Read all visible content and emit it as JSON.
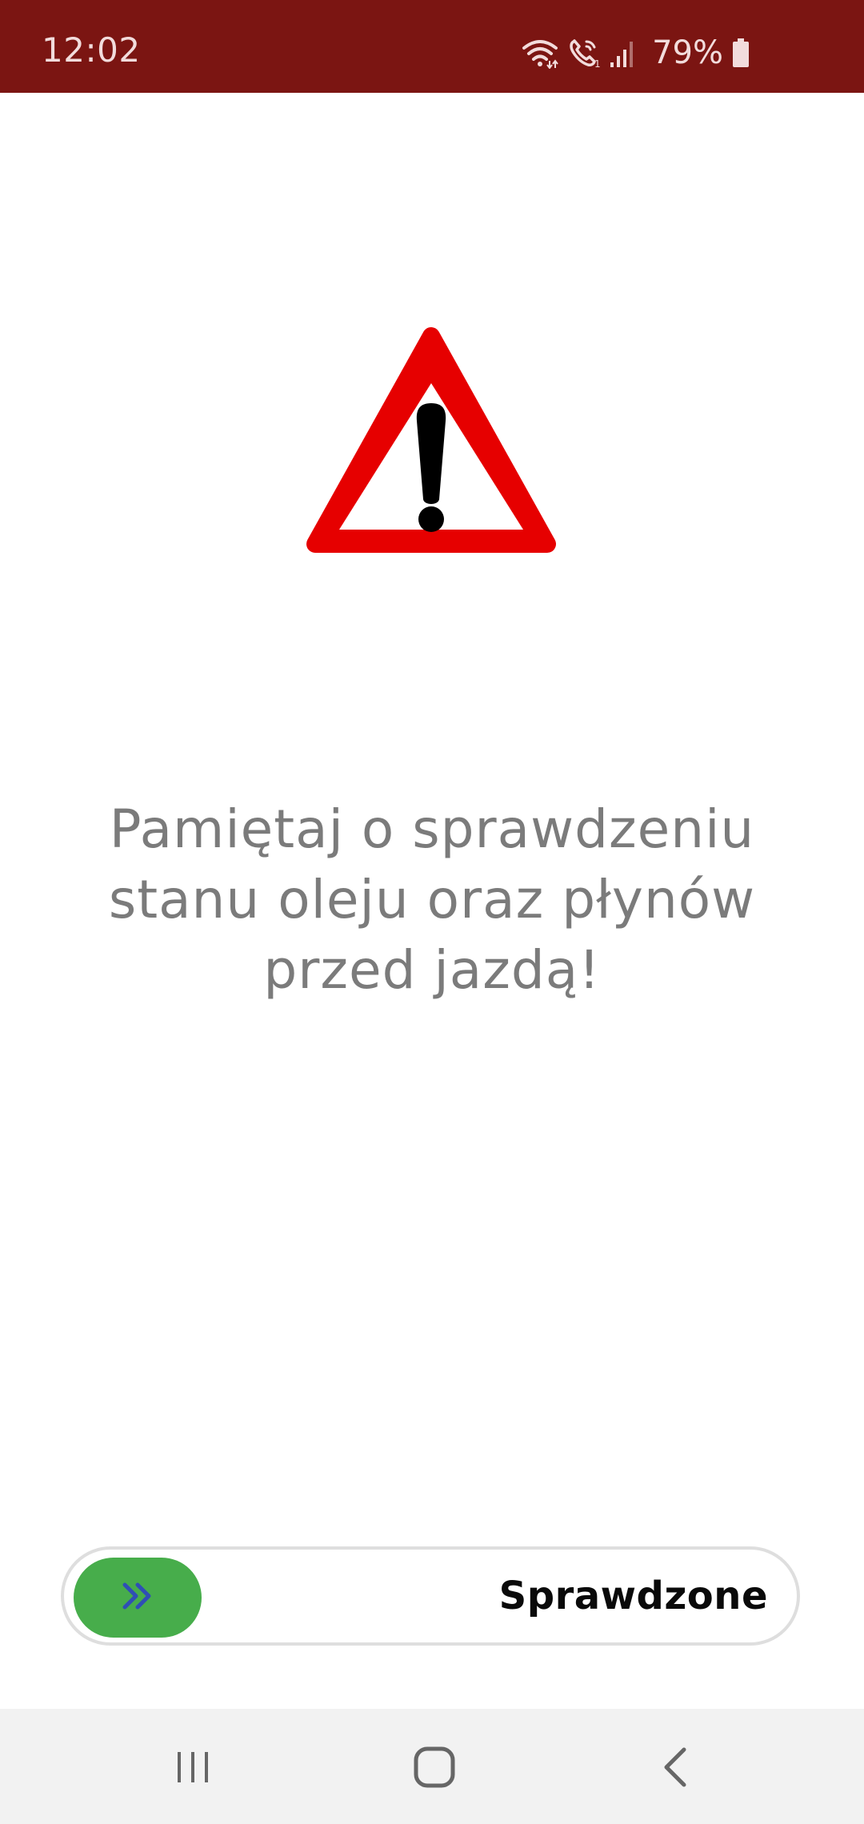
{
  "status_bar": {
    "time": "12:02",
    "battery": "79%",
    "icons": [
      "wifi-icon",
      "wifi-calling-icon",
      "signal-icon",
      "battery-icon"
    ],
    "background": "#7b1512"
  },
  "warning": {
    "icon": "warning-triangle-icon",
    "colors": {
      "border": "#e60000",
      "fill": "#ffffff",
      "mark": "#000000"
    }
  },
  "message": {
    "line1": "Pamiętaj o sprawdzeniu",
    "line2": "stanu oleju oraz płynów",
    "line3": "przed jazdą!",
    "color": "#7b7b7b"
  },
  "slider": {
    "label": "Sprawdzone",
    "knob_icon": "double-chevron-right-icon",
    "knob_color": "#47ad4b",
    "progress": 0
  },
  "nav_bar": {
    "buttons": [
      "recent-apps-icon",
      "home-icon",
      "back-icon"
    ]
  }
}
